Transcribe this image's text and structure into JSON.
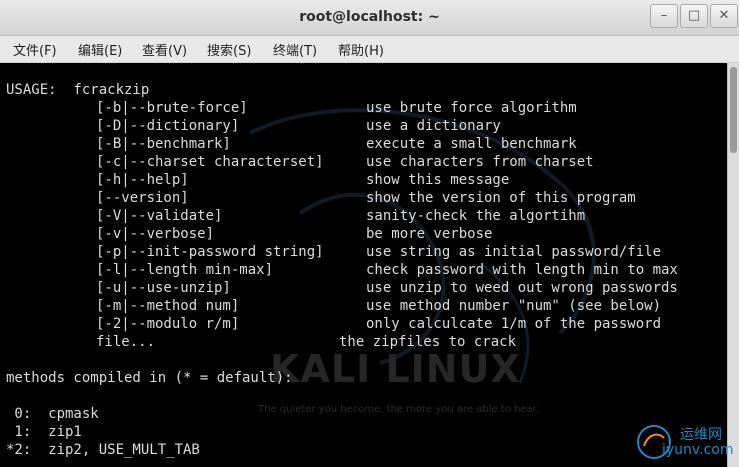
{
  "window": {
    "title": "root@localhost: ~",
    "minimize": "–",
    "maximize": "□",
    "close": "✕"
  },
  "menu": [
    "文件(F)",
    "编辑(E)",
    "查看(V)",
    "搜索(S)",
    "终端(T)",
    "帮助(H)"
  ],
  "terminal": {
    "usage": "USAGE:  fcrackzip",
    "options": [
      {
        "opt": "[-b|--brute-force]",
        "desc": "use brute force algorithm"
      },
      {
        "opt": "[-D|--dictionary]",
        "desc": "use a dictionary"
      },
      {
        "opt": "[-B|--benchmark]",
        "desc": "execute a small benchmark"
      },
      {
        "opt": "[-c|--charset characterset]",
        "desc": "use characters from charset"
      },
      {
        "opt": "[-h|--help]",
        "desc": "show this message"
      },
      {
        "opt": "[--version]",
        "desc": "show the version of this program"
      },
      {
        "opt": "[-V|--validate]",
        "desc": "sanity-check the algortihm"
      },
      {
        "opt": "[-v|--verbose]",
        "desc": "be more verbose"
      },
      {
        "opt": "[-p|--init-password string]",
        "desc": "use string as initial password/file"
      },
      {
        "opt": "[-l|--length min-max]",
        "desc": "check password with length min to max"
      },
      {
        "opt": "[-u|--use-unzip]",
        "desc": "use unzip to weed out wrong passwords"
      },
      {
        "opt": "[-m|--method num]",
        "desc": "use method number \"num\" (see below)"
      },
      {
        "opt": "[-2|--modulo r/m]",
        "desc": "only calculcate 1/m of the password"
      }
    ],
    "file_arg": "file...",
    "file_desc": "the zipfiles to crack",
    "methods_header": "methods compiled in (* = default):",
    "methods": [
      " 0:  cpmask",
      " 1:  zip1",
      "*2:  zip2, USE_MULT_TAB"
    ]
  },
  "background": {
    "logo": "KALI LINUX",
    "tagline": "The quieter you become, the more you are able to hear."
  },
  "watermark": {
    "line1": "运维网",
    "line2": "iyunv.com"
  }
}
